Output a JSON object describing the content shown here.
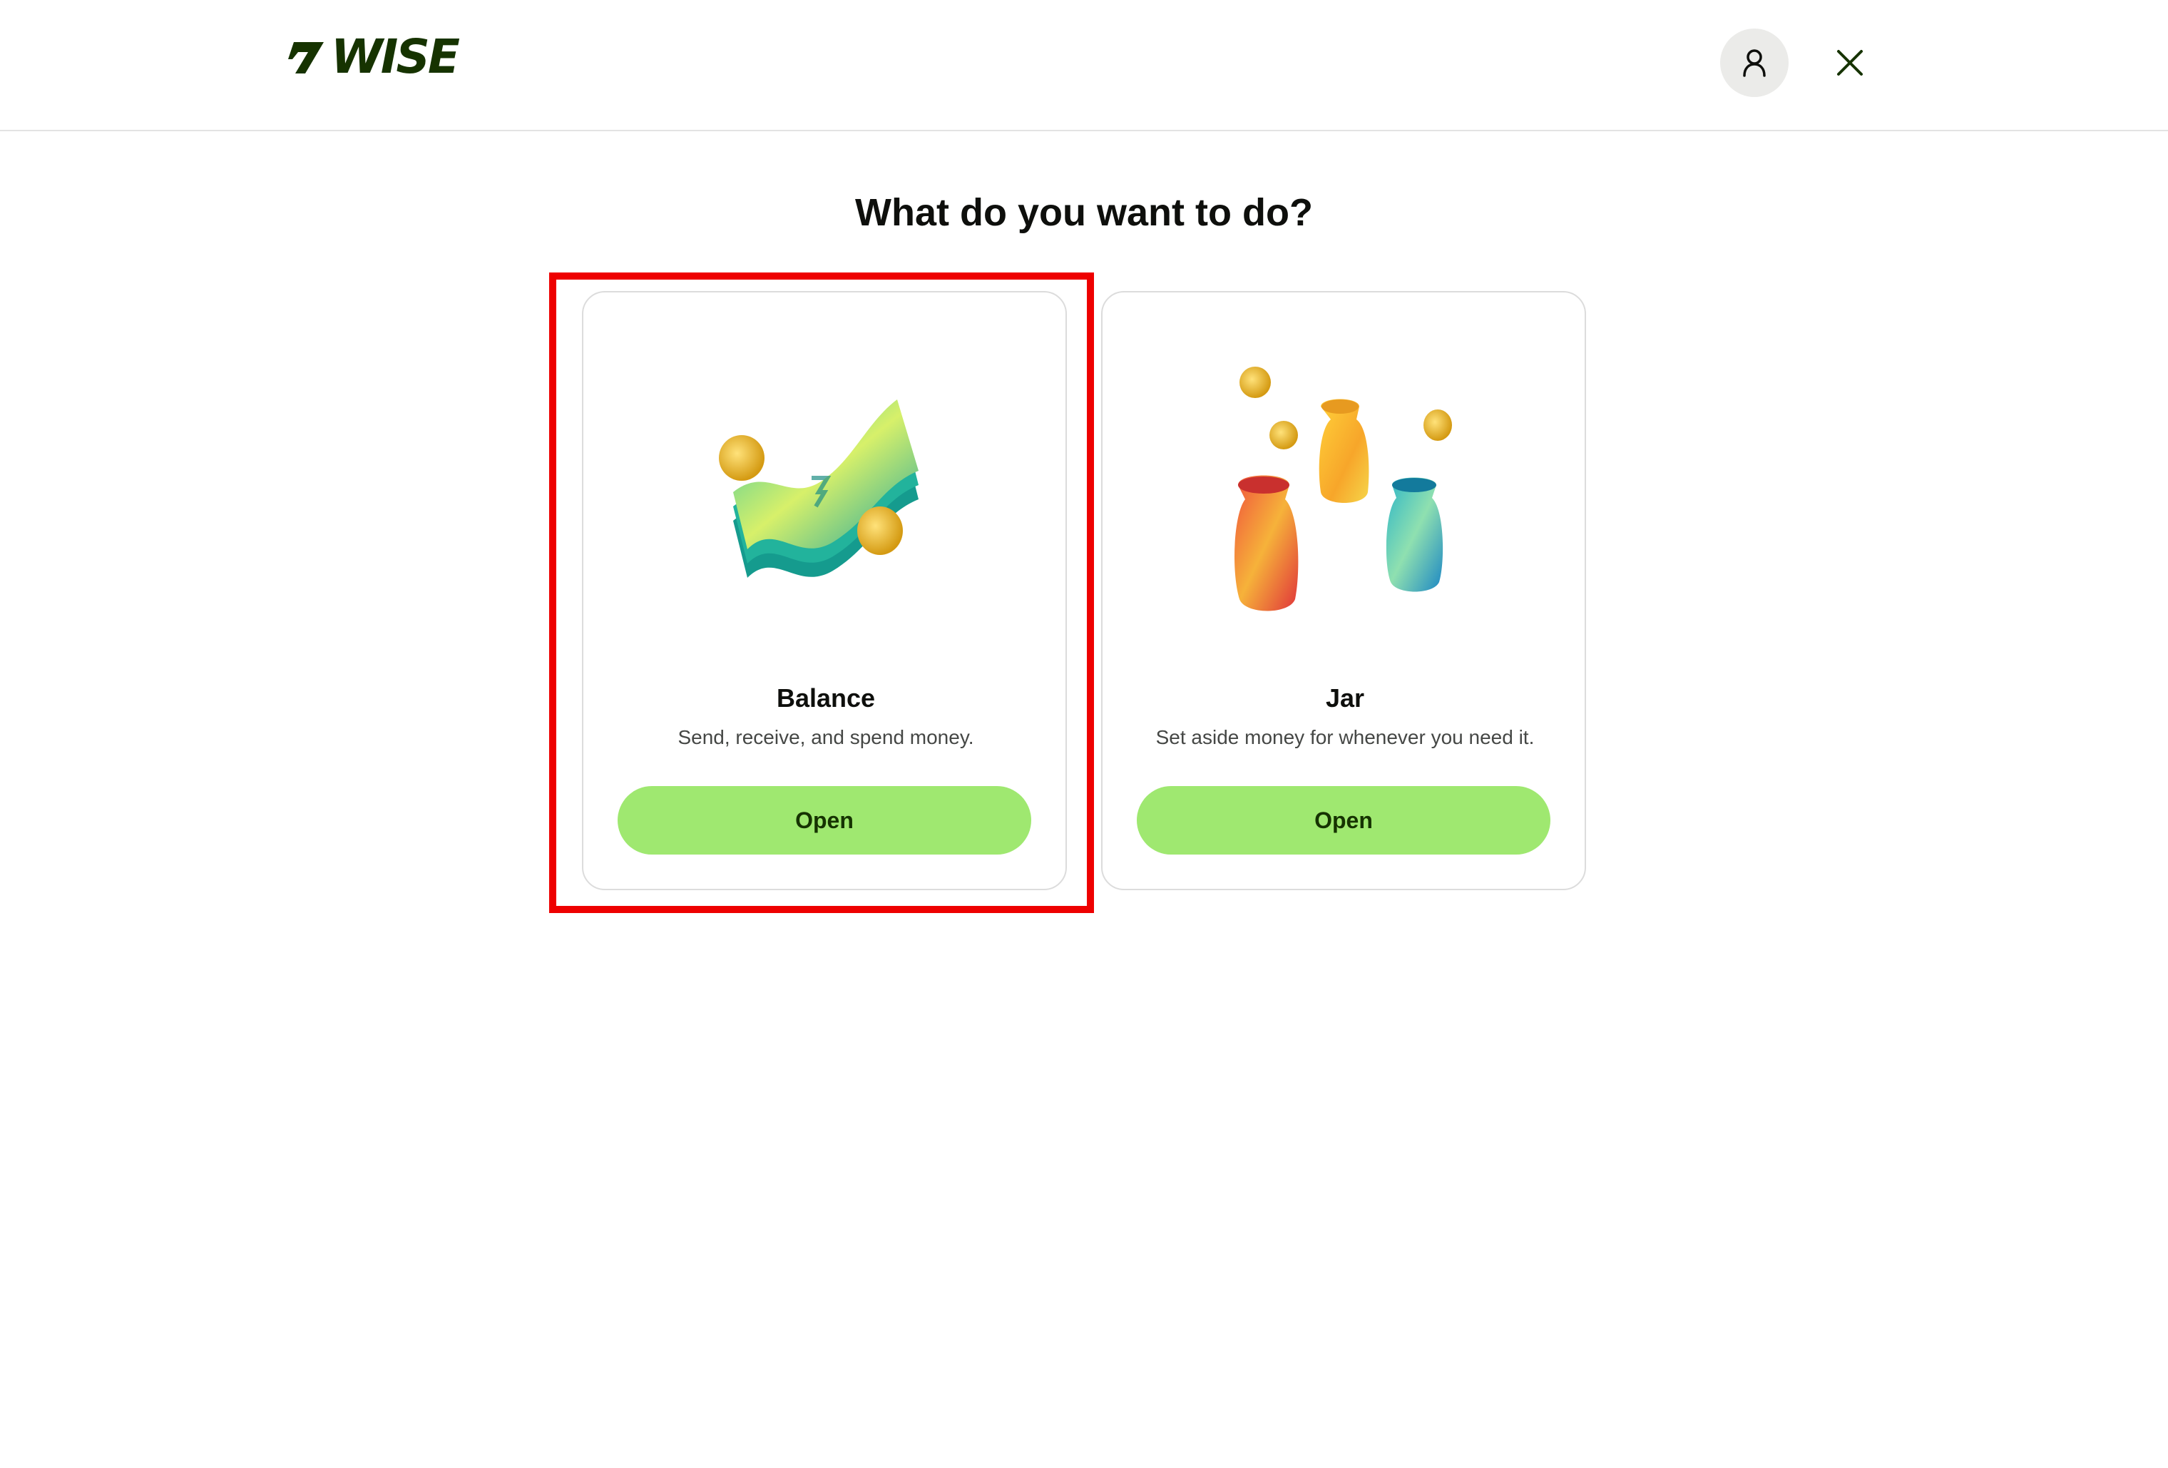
{
  "header": {
    "logo_text": "WISE",
    "account_icon": "user-icon",
    "close_icon": "close-icon",
    "brand_color": "#163300"
  },
  "main": {
    "title": "What do you want to do?",
    "cards": [
      {
        "title": "Balance",
        "description": "Send, receive, and spend money.",
        "button_label": "Open",
        "illustration": "banknotes-illustration"
      },
      {
        "title": "Jar",
        "description": "Set aside money for whenever you need it.",
        "button_label": "Open",
        "illustration": "jars-illustration"
      }
    ],
    "button_color": "#9fe870",
    "highlight_color": "#ee0000"
  }
}
